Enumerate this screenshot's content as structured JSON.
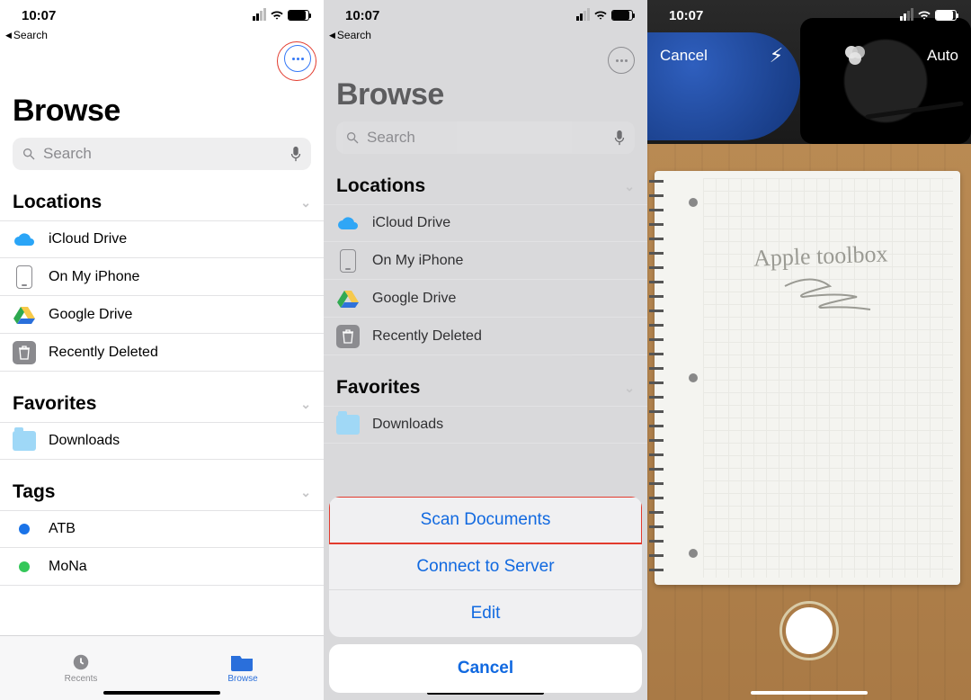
{
  "status_time": "10:07",
  "back_label": "Search",
  "browse_title": "Browse",
  "search_placeholder": "Search",
  "locations_header": "Locations",
  "locations": {
    "icloud": "iCloud Drive",
    "on_my_iphone": "On My iPhone",
    "google_drive": "Google Drive",
    "recently_deleted": "Recently Deleted"
  },
  "favorites_header": "Favorites",
  "favorites": {
    "downloads": "Downloads"
  },
  "tags_header": "Tags",
  "tags": {
    "atb": "ATB",
    "mona": "MoNa"
  },
  "tabbar": {
    "recents": "Recents",
    "browse": "Browse"
  },
  "sheet": {
    "scan": "Scan Documents",
    "connect": "Connect to Server",
    "edit": "Edit",
    "cancel": "Cancel"
  },
  "camera": {
    "cancel": "Cancel",
    "auto": "Auto",
    "notebook_text": "Apple toolbox"
  }
}
